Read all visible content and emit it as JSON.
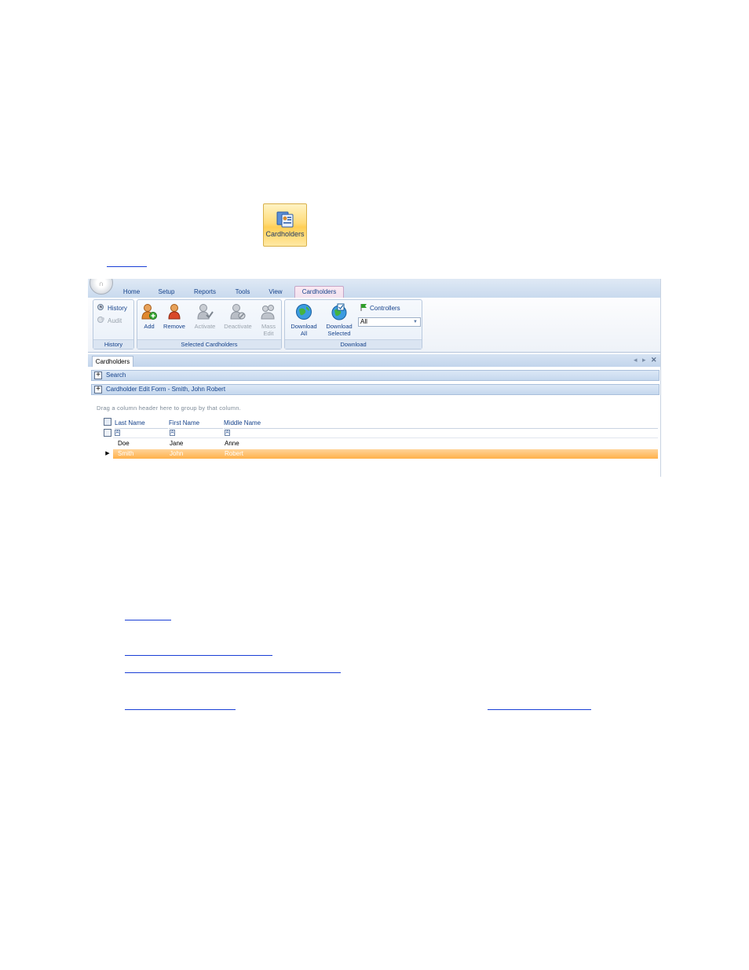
{
  "floating_button": {
    "label": "Cardholders"
  },
  "app": {
    "orb_label": "∩",
    "tabs": [
      {
        "label": "Home"
      },
      {
        "label": "Setup"
      },
      {
        "label": "Reports"
      },
      {
        "label": "Tools"
      },
      {
        "label": "View"
      },
      {
        "label": "Cardholders",
        "active": true
      }
    ],
    "ribbon": {
      "groups": {
        "history": {
          "title": "History",
          "history_label": "History",
          "audit_label": "Audit"
        },
        "selected": {
          "title": "Selected Cardholders",
          "add": "Add",
          "remove": "Remove",
          "activate": "Activate",
          "deactivate": "Deactivate",
          "mass_edit_1": "Mass",
          "mass_edit_2": "Edit"
        },
        "download": {
          "title": "Download",
          "download_all_1": "Download",
          "download_all_2": "All",
          "download_selected_1": "Download",
          "download_selected_2": "Selected",
          "controllers_label": "Controllers",
          "controllers_value": "All"
        }
      }
    },
    "document_tab": "Cardholders",
    "search_label": "Search",
    "edit_form_label": "Cardholder Edit Form - Smith, John Robert",
    "grid": {
      "group_hint": "Drag a column header here to group by that column.",
      "columns": [
        "Last Name",
        "First Name",
        "Middle Name"
      ],
      "rows": [
        {
          "last": "Doe",
          "first": "Jane",
          "middle": "Anne",
          "selected": false
        },
        {
          "last": "Smith",
          "first": "John",
          "middle": "Robert",
          "selected": true
        }
      ]
    }
  },
  "colors": {
    "ribbon_text": "#15428b",
    "selected_row": "#ffb04a",
    "link": "#1a3fd6"
  }
}
